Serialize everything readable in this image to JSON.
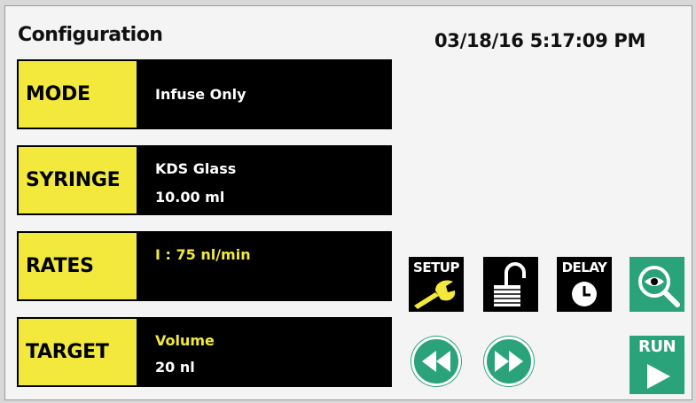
{
  "header": {
    "title": "Configuration",
    "datetime": "03/18/16 5:17:09 PM"
  },
  "config_rows": [
    {
      "label": "MODE",
      "value_line1": "Infuse Only",
      "value_line2": ""
    },
    {
      "label": "SYRINGE",
      "value_line1": "KDS Glass",
      "value_line2": "10.00 ml"
    },
    {
      "label": "RATES",
      "value_line1": "I : 75 nl/min",
      "value_line2": ""
    },
    {
      "label": "TARGET",
      "value_line1": "Volume",
      "value_line2": "20 nl"
    }
  ],
  "buttons": {
    "setup_label": "SETUP",
    "delay_label": "DELAY",
    "run_label": "RUN",
    "icons": [
      "wrench-icon",
      "unlock-icon",
      "clock-icon",
      "eye-magnifier-icon",
      "rewind-icon",
      "fast-forward-icon",
      "play-icon"
    ]
  },
  "colors": {
    "label_yellow": "#f2e93c",
    "button_teal": "#2aa37a",
    "panel_black": "#000000"
  }
}
